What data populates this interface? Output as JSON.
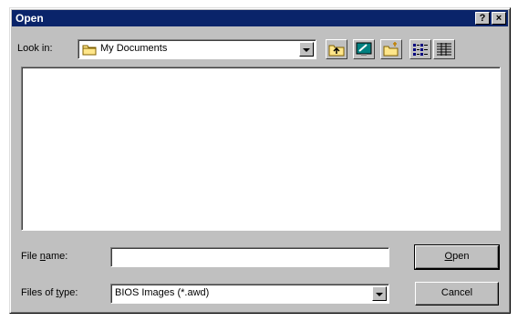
{
  "window": {
    "title": "Open",
    "help_label": "?",
    "close_label": "×"
  },
  "look_in": {
    "label": "Look in:",
    "value": "My Documents"
  },
  "toolbar": {
    "icons": [
      "up-one-level-icon",
      "desktop-icon",
      "new-folder-icon",
      "list-view-icon",
      "details-view-icon"
    ]
  },
  "file_name": {
    "label": "File name:",
    "value": ""
  },
  "files_of_type": {
    "label": "Files of type:",
    "value": "BIOS Images (*.awd)"
  },
  "buttons": {
    "open": "Open",
    "cancel": "Cancel"
  },
  "colors": {
    "titlebar": "#0a246a",
    "face": "#c0c0c0"
  }
}
